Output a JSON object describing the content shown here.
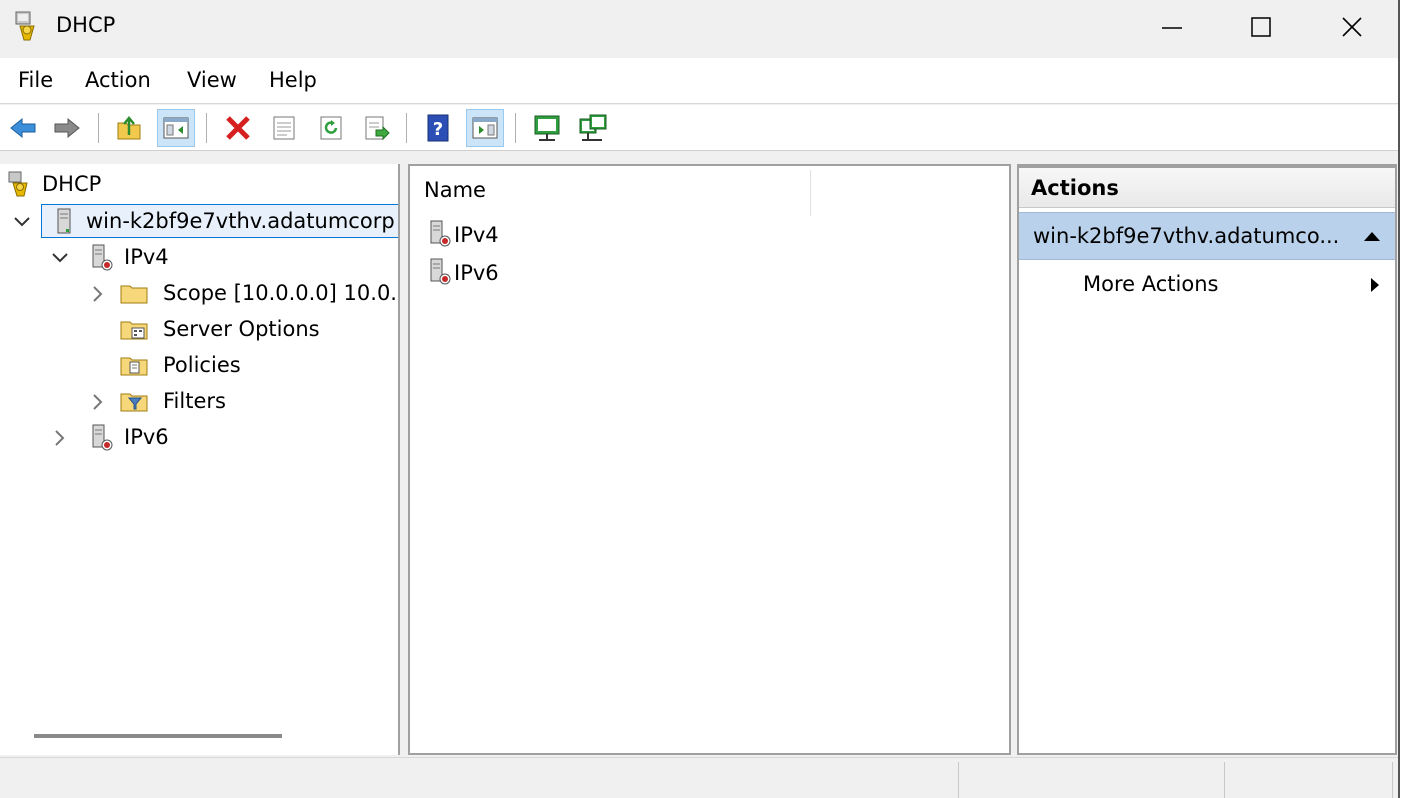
{
  "window": {
    "title": "DHCP"
  },
  "menu": [
    "File",
    "Action",
    "View",
    "Help"
  ],
  "toolbar": {
    "buttons": [
      "back-arrow-icon",
      "forward-arrow-icon",
      "up-folder-icon",
      "show-hide-console-tree-icon",
      "delete-icon",
      "properties-icon",
      "refresh-icon",
      "export-list-icon",
      "help-icon",
      "show-hide-action-pane-icon",
      "authorize-server-icon",
      "manage-servers-icon"
    ]
  },
  "tree": {
    "root": "DHCP",
    "server": "win-k2bf9e7vthv.adatumcorp",
    "ipv4": "IPv4",
    "scope": "Scope [10.0.0.0] 10.0.0.",
    "server_options": "Server Options",
    "policies": "Policies",
    "filters": "Filters",
    "ipv6": "IPv6"
  },
  "list": {
    "column_name": "Name",
    "items": [
      "IPv4",
      "IPv6"
    ]
  },
  "actions": {
    "header": "Actions",
    "group": "win-k2bf9e7vthv.adatumco...",
    "more": "More Actions"
  }
}
